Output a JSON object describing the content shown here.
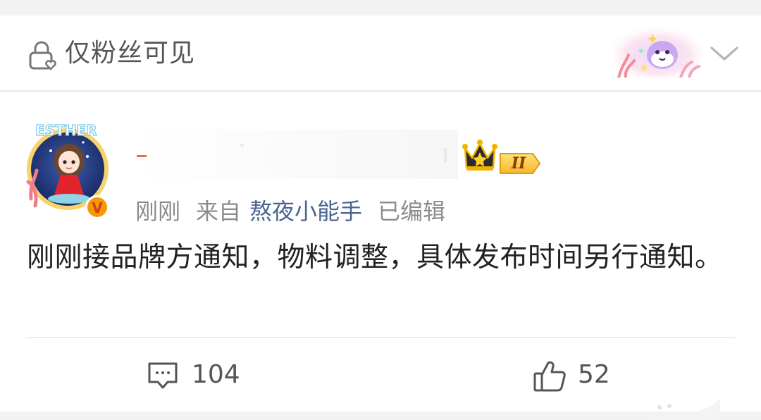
{
  "visibility": {
    "label": "仅粉丝可见",
    "icon": "lock-heart-icon"
  },
  "author": {
    "avatar_text": "ESTHER",
    "verified_badge": "V",
    "level_badge": "II",
    "crown_icon": "crown-icon"
  },
  "meta": {
    "time": "刚刚",
    "source_prefix": "来自",
    "source": "熬夜小能手",
    "edited": "已编辑"
  },
  "post": {
    "text": "刚刚接品牌方通知，物料调整，具体发布时间另行通知。"
  },
  "actions": {
    "comments_count": "104",
    "likes_count": "52"
  },
  "colors": {
    "link": "#4a6390",
    "muted": "#8c8c8c",
    "text": "#222222",
    "verified": "#f59a00",
    "crown": "#f0b400"
  }
}
